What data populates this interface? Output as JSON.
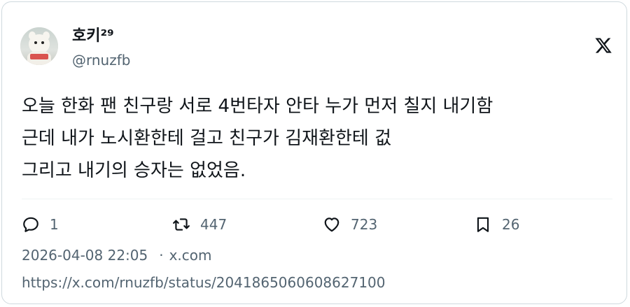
{
  "author": {
    "display_name": "호키²⁹",
    "handle": "@rnuzfb"
  },
  "tweet": {
    "lines": [
      "오늘 한화 팬 친구랑 서로 4번타자 안타 누가 먼저 칠지 내기함",
      "근데 내가 노시환한테 걸고 친구가 김재환한테 겂",
      "그리고 내기의 승자는 없었음."
    ]
  },
  "actions": {
    "reply_count": "1",
    "retweet_count": "447",
    "like_count": "723",
    "bookmark_count": "26"
  },
  "meta": {
    "timestamp": "2026-04-08 22:05",
    "separator": "·",
    "source": "x.com",
    "url": "https://x.com/rnuzfb/status/2041865060608627100"
  },
  "icons": {
    "brand": "x-logo-icon",
    "reply": "reply-icon",
    "retweet": "retweet-icon",
    "like": "heart-icon",
    "bookmark": "bookmark-icon"
  },
  "colors": {
    "text": "#0f1419",
    "secondary": "#536471",
    "border": "#cfd9de"
  }
}
